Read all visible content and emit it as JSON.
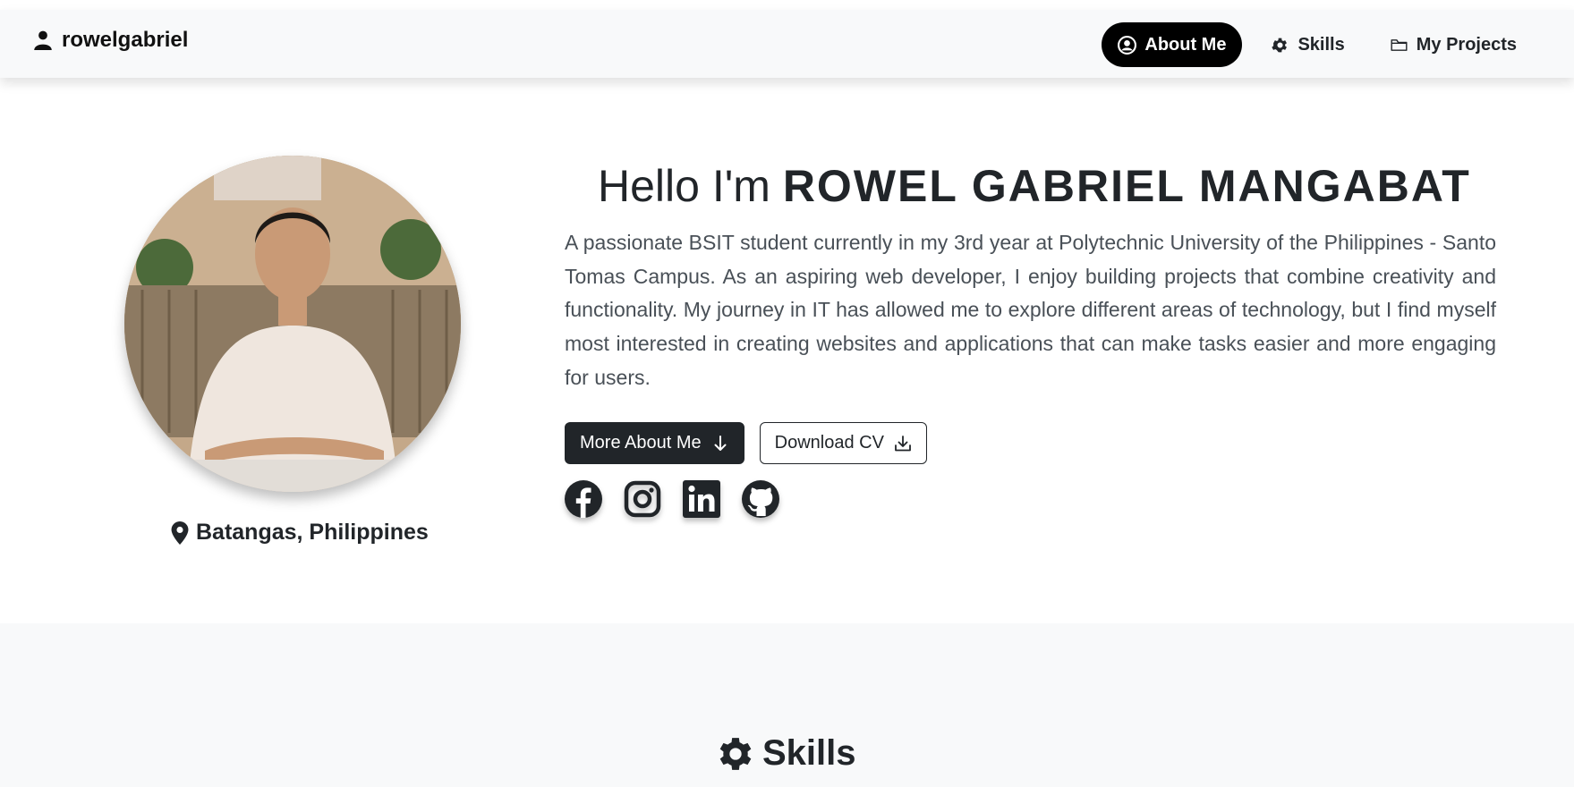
{
  "navbar": {
    "brand": "rowelgabriel",
    "links": [
      {
        "label": "About Me",
        "icon": "user-circle-icon",
        "active": true
      },
      {
        "label": "Skills",
        "icon": "gear-icon",
        "active": false
      },
      {
        "label": "My Projects",
        "icon": "folder-icon",
        "active": false
      }
    ]
  },
  "hero": {
    "greeting": "Hello I'm",
    "name": "ROWEL GABRIEL MANGABAT",
    "bio": "A passionate BSIT student currently in my 3rd year at Polytechnic University of the Philippines - Santo Tomas Campus. As an aspiring web developer, I enjoy building projects that combine creativity and functionality. My journey in IT has allowed me to explore different areas of technology, but I find myself most interested in creating websites and applications that can make tasks easier and more engaging for users.",
    "location": "Batangas, Philippines",
    "buttons": {
      "more": "More About Me",
      "download": "Download CV"
    },
    "socials": [
      "facebook-icon",
      "instagram-icon",
      "linkedin-icon",
      "github-icon"
    ]
  },
  "skills": {
    "title": "Skills"
  },
  "colors": {
    "dark": "#212529",
    "navbar_bg": "#f8f9fa",
    "active_pill": "#000000"
  }
}
